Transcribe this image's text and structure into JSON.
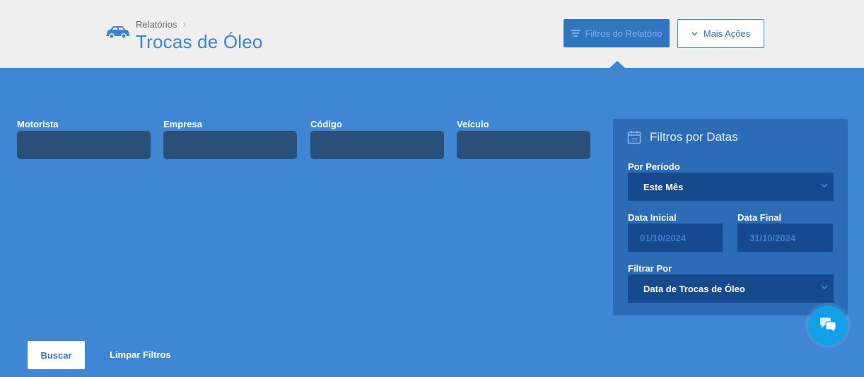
{
  "header": {
    "breadcrumb": "Relatórios",
    "title": "Trocas de Óleo",
    "filters_button": "Filtros do Relatório",
    "more_actions_button": "Mais Ações"
  },
  "filters": [
    {
      "label": "Motorista",
      "value": ""
    },
    {
      "label": "Empresa",
      "value": ""
    },
    {
      "label": "Código",
      "value": ""
    },
    {
      "label": "Veículo",
      "value": ""
    }
  ],
  "date_filters": {
    "title": "Filtros por Datas",
    "period_label": "Por Período",
    "period_value": "Este Mês",
    "start_label": "Data Inicial",
    "start_value": "01/10/2024",
    "end_label": "Data Final",
    "end_value": "31/10/2024",
    "filter_by_label": "Filtrar Por",
    "filter_by_value": "Data de Trocas de Óleo"
  },
  "actions": {
    "search": "Buscar",
    "clear": "Limpar Filtros"
  },
  "colors": {
    "panel": "#3f87d4",
    "title": "#3b86d4",
    "input": "#2a4f79",
    "select": "#164a8e",
    "chat": "#12a0e8"
  }
}
